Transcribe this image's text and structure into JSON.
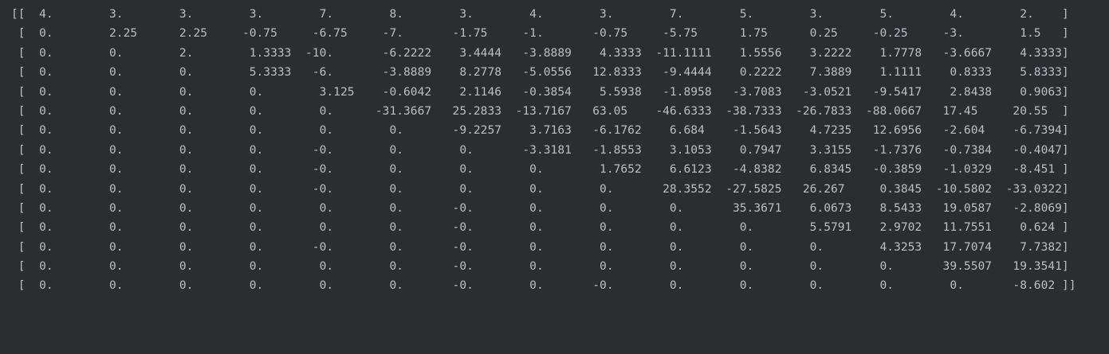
{
  "console": {
    "rows": [
      "[[  4.        3.        3.        3.        7.        8.        3.        4.        3.        7.        5.        3.        5.        4.        2.    ]",
      " [  0.        2.25      2.25     -0.75     -6.75     -7.       -1.75     -1.       -0.75     -5.75      1.75      0.25     -0.25     -3.        1.5   ]",
      " [  0.        0.        2.        1.3333  -10.       -6.2222    3.4444   -3.8889    4.3333  -11.1111    1.5556    3.2222    1.7778   -3.6667    4.3333]",
      " [  0.        0.        0.        5.3333   -6.       -3.8889    8.2778   -5.0556   12.8333   -9.4444    0.2222    7.3889    1.1111    0.8333    5.8333]",
      " [  0.        0.        0.        0.        3.125    -0.6042    2.1146   -0.3854    5.5938   -1.8958   -3.7083   -3.0521   -9.5417    2.8438    0.9063]",
      " [  0.        0.        0.        0.        0.      -31.3667   25.2833  -13.7167   63.05    -46.6333  -38.7333  -26.7833  -88.0667   17.45     20.55  ]",
      " [  0.        0.        0.        0.        0.        0.       -9.2257    3.7163   -6.1762    6.684    -1.5643    4.7235   12.6956   -2.604    -6.7394]",
      " [  0.        0.        0.        0.       -0.        0.        0.       -3.3181   -1.8553    3.1053    0.7947    3.3155   -1.7376   -0.7384   -0.4047]",
      " [  0.        0.        0.        0.       -0.        0.        0.        0.        1.7652    6.6123   -4.8382    6.8345   -0.3859   -1.0329   -8.451 ]",
      " [  0.        0.        0.        0.       -0.        0.        0.        0.        0.       28.3552  -27.5825   26.267     0.3845  -10.5802  -33.0322]",
      " [  0.        0.        0.        0.        0.        0.       -0.        0.        0.        0.       35.3671    6.0673    8.5433   19.0587   -2.8069]",
      " [  0.        0.        0.        0.        0.        0.       -0.        0.        0.        0.        0.        5.5791    2.9702   11.7551    0.624 ]",
      " [  0.        0.        0.        0.       -0.        0.       -0.        0.        0.        0.        0.        0.        4.3253   17.7074    7.7382]",
      " [  0.        0.        0.        0.        0.        0.       -0.        0.        0.        0.        0.        0.        0.       39.5507   19.3541]",
      " [  0.        0.        0.        0.        0.        0.       -0.        0.       -0.        0.        0.        0.        0.        0.       -8.602 ]]"
    ]
  }
}
